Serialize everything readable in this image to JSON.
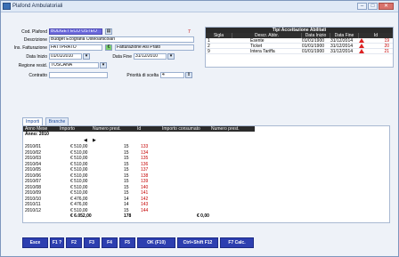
{
  "window": {
    "title": "Plafond Ambulatoriali"
  },
  "form": {
    "cod_plafond_label": "Cod. Plafond",
    "cod_plafond_value": "BUDGET ECO OSTEO",
    "cod_plafond_num": "7",
    "descrizione_label": "Descrizione",
    "descrizione_value": "Budget Ecografia Osteoarticolari",
    "ins_fatt_label": "Ins. Fatturazione",
    "ins_fatt_value": "FATTPRATO",
    "ins_fatt_code": "€",
    "ins_fatt_desc": "Fatturazione Asl Prato",
    "data_inizio_label": "Data Inizio",
    "data_inizio_value": "01/01/2010",
    "data_fine_label": "Data Fine",
    "data_fine_value": "31/12/2010",
    "regione_label": "Regione resid.",
    "regione_value": "TOSCANA",
    "contratto_label": "Contratto",
    "contratto_value": "",
    "priorita_label": "Priorità di scelta",
    "priorita_value": "4"
  },
  "tipi": {
    "title": "Tipi Accettazione Abilitati",
    "columns": [
      "Sigla",
      "Descr. Abbr.",
      "Data Inizio",
      "Data Fine",
      "Id"
    ],
    "rows": [
      {
        "sigla": "1",
        "descr": "Esente",
        "inizio": "01/01/1900",
        "fine": "31/12/2014",
        "id": "19"
      },
      {
        "sigla": "2",
        "descr": "Ticket",
        "inizio": "01/01/1900",
        "fine": "31/12/2014",
        "id": "20"
      },
      {
        "sigla": "9",
        "descr": "Intera Tariffa",
        "inizio": "01/01/1900",
        "fine": "31/12/2014",
        "id": "21"
      }
    ]
  },
  "tabs": [
    "Importi",
    "Branche"
  ],
  "importi": {
    "columns": [
      "Anno Mese",
      "Importo",
      "Numero prest.",
      "Id",
      "Importo consumato",
      "Numero prest. consumato"
    ],
    "group": "Anno: 2010",
    "rows": [
      {
        "mese": "2010/01",
        "importo": "€ 510,00",
        "num": "15",
        "id": "133"
      },
      {
        "mese": "2010/02",
        "importo": "€ 510,00",
        "num": "15",
        "id": "134"
      },
      {
        "mese": "2010/03",
        "importo": "€ 510,00",
        "num": "15",
        "id": "135"
      },
      {
        "mese": "2010/04",
        "importo": "€ 510,00",
        "num": "15",
        "id": "136"
      },
      {
        "mese": "2010/05",
        "importo": "€ 510,00",
        "num": "15",
        "id": "137"
      },
      {
        "mese": "2010/06",
        "importo": "€ 510,00",
        "num": "15",
        "id": "138"
      },
      {
        "mese": "2010/07",
        "importo": "€ 510,00",
        "num": "15",
        "id": "139"
      },
      {
        "mese": "2010/08",
        "importo": "€ 510,00",
        "num": "15",
        "id": "140"
      },
      {
        "mese": "2010/09",
        "importo": "€ 510,00",
        "num": "15",
        "id": "141"
      },
      {
        "mese": "2010/10",
        "importo": "€ 476,00",
        "num": "14",
        "id": "142"
      },
      {
        "mese": "2010/11",
        "importo": "€ 476,00",
        "num": "14",
        "id": "143"
      },
      {
        "mese": "2010/12",
        "importo": "€ 510,00",
        "num": "15",
        "id": "144"
      }
    ],
    "total_importo": "€ 6.052,00",
    "total_num": "178",
    "total_consumato": "€ 0,00"
  },
  "toolbar": {
    "esce": "Esce",
    "f1": "F1 ?",
    "f2": "F2",
    "f3": "F3",
    "f4": "F4",
    "f5": "F5",
    "ok": "OK (F10)",
    "ctrl": "Ctrl+Shift F12",
    "f7": "F7 Calc."
  }
}
